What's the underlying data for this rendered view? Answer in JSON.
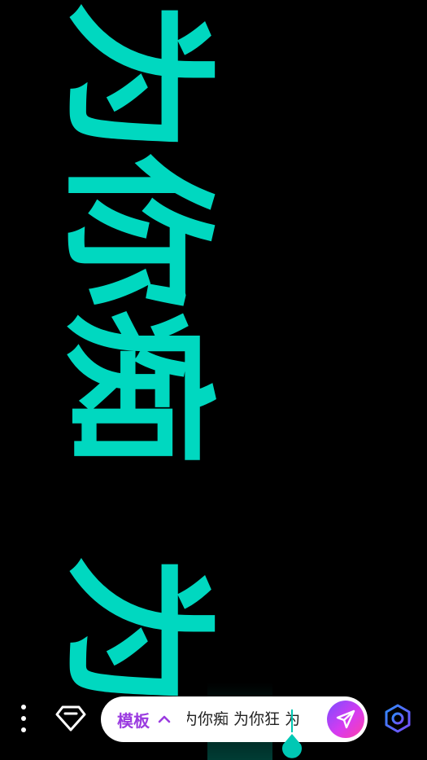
{
  "marquee": {
    "phrase": "为你痴",
    "repeat_text": "为",
    "color": "#00D8C0",
    "background": "#000000"
  },
  "toolbar": {
    "template_label": "模板",
    "input_value": "为你痴  为你狂  为",
    "accent_purple": "#9B3BE0",
    "caret_color": "#00C8B4"
  },
  "icons": {
    "menu": "more-vertical-icon",
    "vip": "diamond-icon",
    "template_toggle": "chevron-up-icon",
    "send": "paper-plane-icon",
    "settings": "hexagon-gear-icon"
  }
}
